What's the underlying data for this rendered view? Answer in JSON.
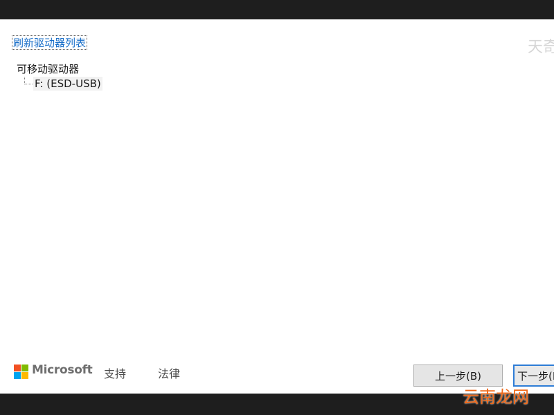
{
  "header": {
    "refresh_link": "刷新驱动器列表"
  },
  "drive_tree": {
    "root_label": "可移动驱动器",
    "items": [
      {
        "label": "F: (ESD-USB)"
      }
    ]
  },
  "footer": {
    "brand": "Microsoft",
    "links": [
      {
        "label": "支持"
      },
      {
        "label": "法律"
      }
    ],
    "buttons": {
      "back": "上一步(B)",
      "next": "下一步(N)"
    }
  },
  "watermarks": {
    "top": "天奇",
    "bottom": "云南龙网"
  },
  "colors": {
    "link": "#1a6fc9",
    "accent_border": "#2d7cd6",
    "logo_red": "#f25022",
    "logo_green": "#7fba00",
    "logo_blue": "#00a4ef",
    "logo_yellow": "#ffb900"
  }
}
